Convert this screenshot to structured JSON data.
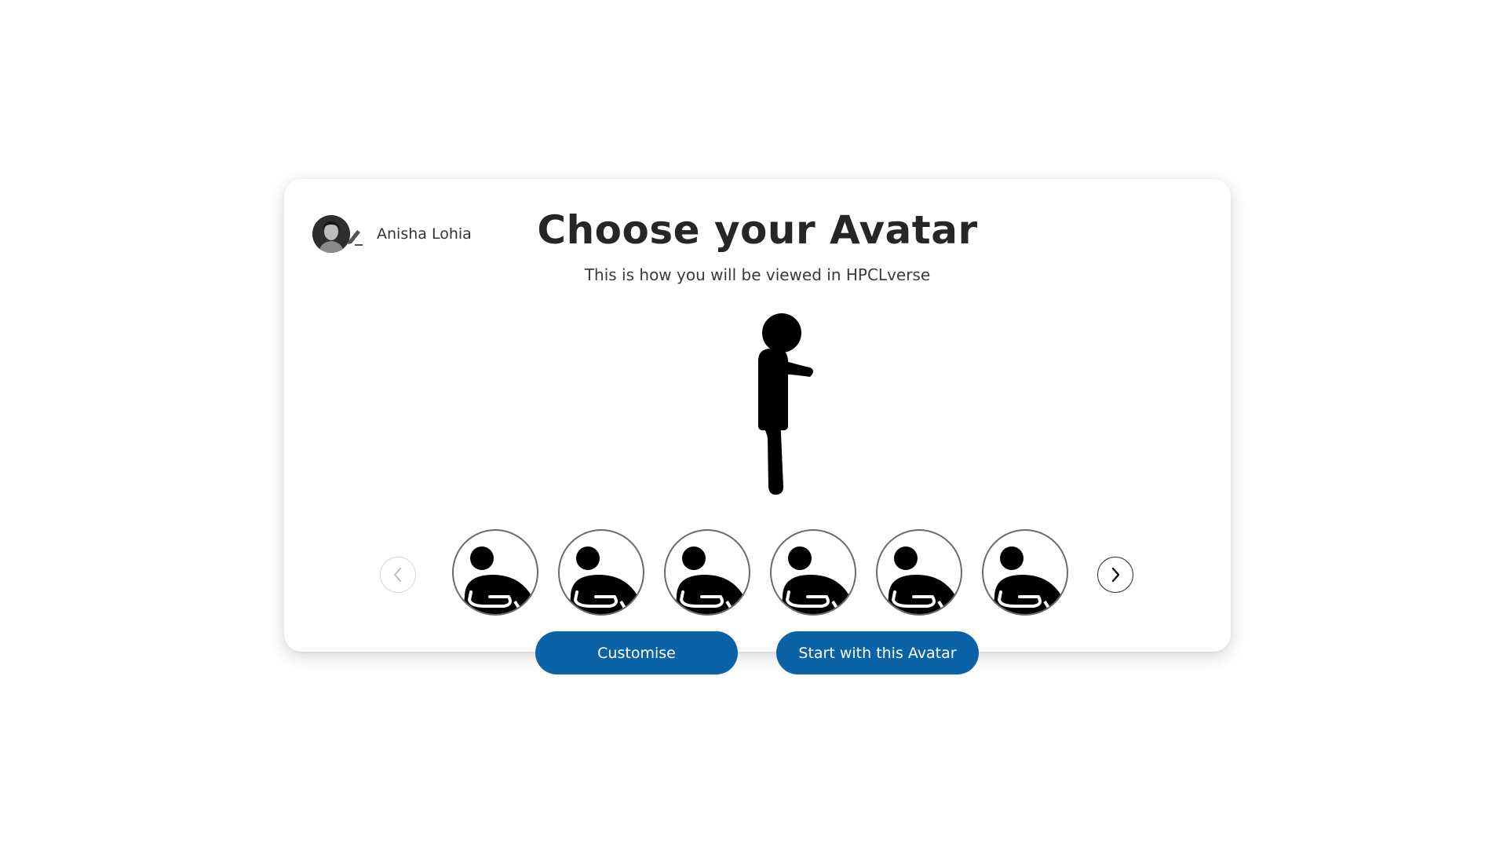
{
  "user": {
    "name": "Anisha Lohia",
    "avatar_icon": "user-photo-icon",
    "edit_icon": "pencil-icon"
  },
  "header": {
    "title": "Choose your Avatar",
    "subtitle": "This is how you will be viewed in HPCLverse"
  },
  "preview": {
    "icon": "standing-avatar-figure"
  },
  "carousel": {
    "prev_icon": "chevron-left-icon",
    "next_icon": "chevron-right-icon",
    "items": [
      {
        "icon": "avatar-option-icon"
      },
      {
        "icon": "avatar-option-icon"
      },
      {
        "icon": "avatar-option-icon"
      },
      {
        "icon": "avatar-option-icon"
      },
      {
        "icon": "avatar-option-icon"
      },
      {
        "icon": "avatar-option-icon"
      }
    ]
  },
  "actions": {
    "customise_label": "Customise",
    "start_label": "Start with this Avatar"
  },
  "colors": {
    "primary_button": "#0b62a7",
    "text_dark": "#262626",
    "page_background": "#ffffff"
  }
}
